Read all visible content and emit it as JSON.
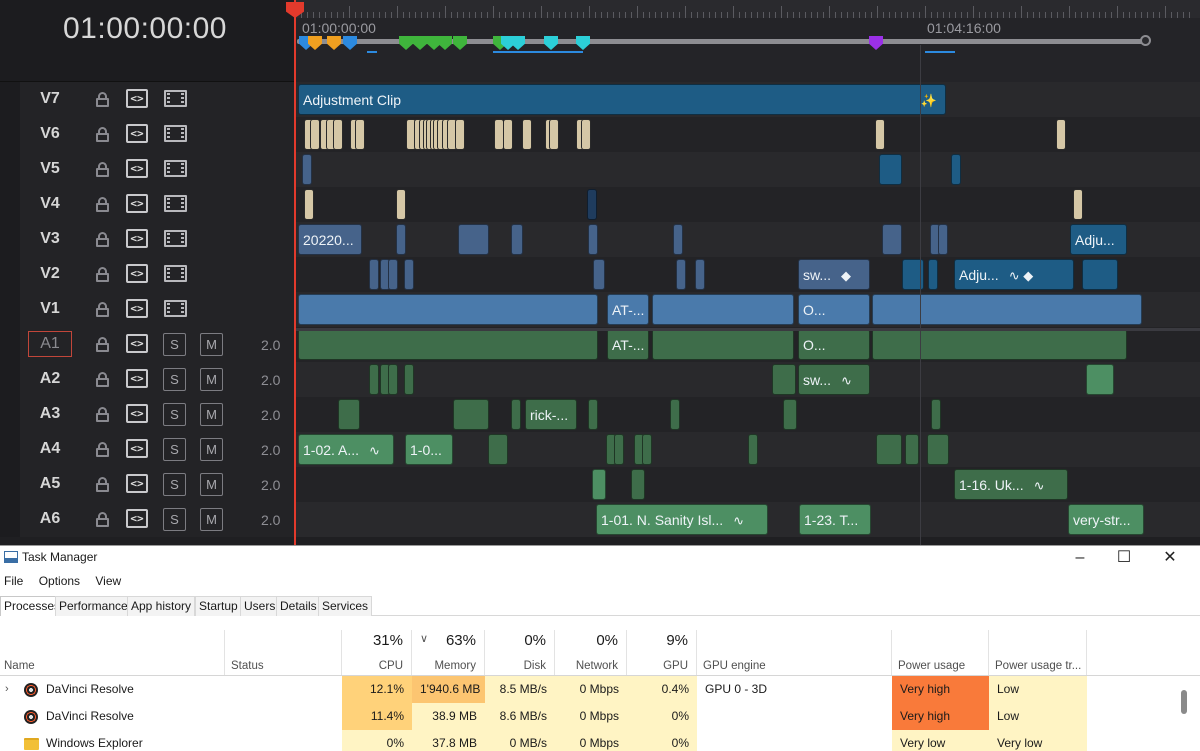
{
  "timeline": {
    "timecode": "01:00:00:00",
    "ruler": {
      "start_label": "01:00:00:00",
      "mid_label": "01:04:16:00"
    },
    "video_tracks": [
      {
        "name": "V7"
      },
      {
        "name": "V6"
      },
      {
        "name": "V5"
      },
      {
        "name": "V4"
      },
      {
        "name": "V3"
      },
      {
        "name": "V2"
      },
      {
        "name": "V1"
      }
    ],
    "audio_tracks": [
      {
        "name": "A1",
        "volume": "2.0",
        "selected": true
      },
      {
        "name": "A2",
        "volume": "2.0"
      },
      {
        "name": "A3",
        "volume": "2.0"
      },
      {
        "name": "A4",
        "volume": "2.0"
      },
      {
        "name": "A5",
        "volume": "2.0"
      },
      {
        "name": "A6",
        "volume": "2.0"
      }
    ],
    "auto_btn_glyph": "<>",
    "solo_label": "S",
    "mute_label": "M",
    "clips": {
      "v7_adjustment": "Adjustment Clip",
      "v3_first": "20220...",
      "v3_last": "Adju...",
      "v2_sw": "sw...",
      "v2_adju": "Adju...",
      "v1_at": "AT-...",
      "v1_o": "O...",
      "a1_at": "AT-...",
      "a1_o": "O...",
      "a2_sw": "sw...",
      "a3_rick": "rick-...",
      "a4_first": "1-02. A...",
      "a4_second": "1-0...",
      "a5_uk": "1-16. Uk...",
      "a6_sanity": "1-01. N. Sanity Isl...",
      "a6_t": "1-23. T...",
      "a6_very": "very-str..."
    },
    "colors": {
      "playhead": "#e23a2c",
      "video_clip": "#4a7aab",
      "audio_clip": "#3e6d4a",
      "adjustment": "#1e5c85"
    }
  },
  "task_manager": {
    "title": "Task Manager",
    "menu": [
      "File",
      "Options",
      "View"
    ],
    "tabs": [
      "Processes",
      "Performance",
      "App history",
      "Startup",
      "Users",
      "Details",
      "Services"
    ],
    "columns": {
      "name": "Name",
      "status": "Status",
      "cpu": {
        "label": "CPU",
        "total": "31%"
      },
      "memory": {
        "label": "Memory",
        "total": "63%"
      },
      "disk": {
        "label": "Disk",
        "total": "0%"
      },
      "network": {
        "label": "Network",
        "total": "0%"
      },
      "gpu": {
        "label": "GPU",
        "total": "9%"
      },
      "gpu_engine": "GPU engine",
      "power": "Power usage",
      "power_trend": "Power usage tr..."
    },
    "processes": [
      {
        "name": "DaVinci Resolve",
        "cpu": "12.1%",
        "memory": "1'940.6 MB",
        "disk": "8.5 MB/s",
        "network": "0 Mbps",
        "gpu": "0.4%",
        "gpu_engine": "GPU 0 - 3D",
        "power": "Very high",
        "power_trend": "Low"
      },
      {
        "name": "DaVinci Resolve",
        "cpu": "11.4%",
        "memory": "38.9 MB",
        "disk": "8.6 MB/s",
        "network": "0 Mbps",
        "gpu": "0%",
        "gpu_engine": "",
        "power": "Very high",
        "power_trend": "Low"
      },
      {
        "name": "Windows Explorer",
        "cpu": "0%",
        "memory": "37.8 MB",
        "disk": "0 MB/s",
        "network": "0 Mbps",
        "gpu": "0%",
        "gpu_engine": "",
        "power": "Very low",
        "power_trend": "Very low"
      }
    ],
    "heat_colors": {
      "light": "#fff4c4",
      "mid": "#ffe59a",
      "strong": "#ffd27a",
      "memory_hot": "#fcc571",
      "power_hot": "#f97a3a"
    }
  }
}
